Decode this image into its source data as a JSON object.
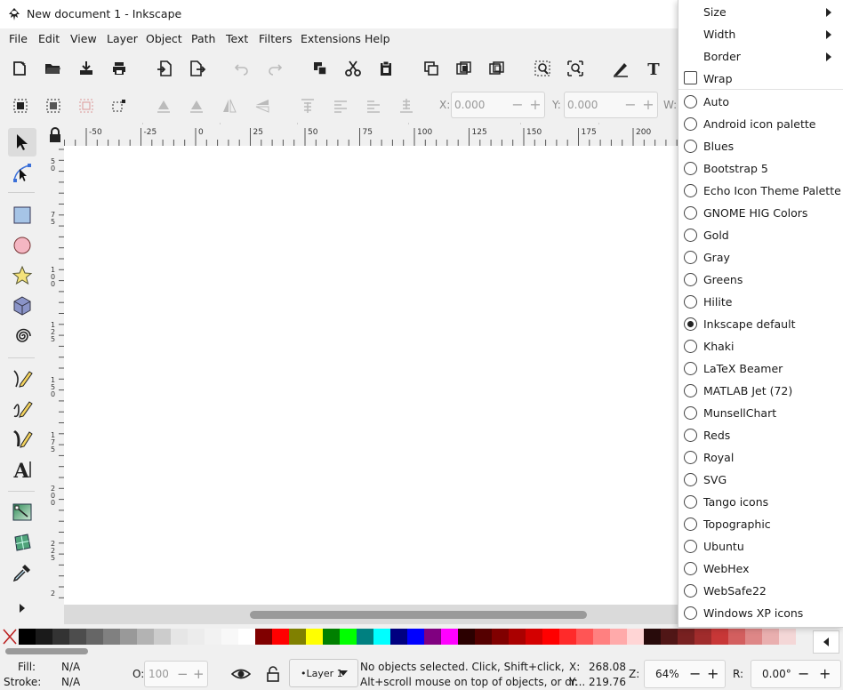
{
  "window": {
    "title": "New document 1 - Inkscape"
  },
  "menubar": [
    "File",
    "Edit",
    "View",
    "Layer",
    "Object",
    "Path",
    "Text",
    "Filters",
    "Extensions",
    "Help"
  ],
  "toolbar2": {
    "x_label": "X:",
    "x_value": "0.000",
    "y_label": "Y:",
    "y_value": "0.000",
    "w_label": "W:"
  },
  "ruler": {
    "h_ticks": [
      "-50",
      "-25",
      "0",
      "25",
      "50",
      "75",
      "100",
      "125",
      "150",
      "175",
      "200"
    ],
    "v_ticks": [
      "5\n0",
      "7\n5",
      "1\n0\n0",
      "1\n2\n5",
      "1\n5\n0",
      "1\n7\n5",
      "2\n0\n0",
      "2\n2\n5",
      "2"
    ]
  },
  "palette": {
    "colors": [
      "#000000",
      "#1a1a1a",
      "#333333",
      "#4d4d4d",
      "#666666",
      "#808080",
      "#999999",
      "#b3b3b3",
      "#cccccc",
      "#e6e6e6",
      "#ececec",
      "#f2f2f2",
      "#f8f8f8",
      "#ffffff",
      "#800000",
      "#ff0000",
      "#808000",
      "#ffff00",
      "#008000",
      "#00ff00",
      "#008080",
      "#00ffff",
      "#000080",
      "#0000ff",
      "#800080",
      "#ff00ff",
      "#2b0000",
      "#550000",
      "#800000",
      "#aa0000",
      "#d40000",
      "#ff0000",
      "#ff2a2a",
      "#ff5555",
      "#ff8080",
      "#ffaaaa",
      "#ffd5d5",
      "#280b0b",
      "#501616",
      "#782121",
      "#a02c2c",
      "#c83737",
      "#d35f5f",
      "#de8787",
      "#e9afaf",
      "#f4d7d7",
      "#241c1c"
    ]
  },
  "status": {
    "fill_label": "Fill:",
    "fill_value": "N/A",
    "stroke_label": "Stroke:",
    "stroke_value": "N/A",
    "opacity_label": "O:",
    "opacity_value": "100",
    "layer": "•Layer 1",
    "message_line1": "No objects selected. Click, Shift+click,",
    "message_line2": "Alt+scroll mouse on top of objects, or dr...",
    "x_label": "X:",
    "x_value": "268.08",
    "y_label": "Y:",
    "y_value": "219.76",
    "zoom_label": "Z:",
    "zoom_value": "64%",
    "rotate_label": "R:",
    "rotate_value": "0.00°"
  },
  "popup": {
    "submenus": [
      "Size",
      "Width",
      "Border"
    ],
    "wrap_label": "Wrap",
    "selected": "Inkscape default",
    "palettes": [
      "Auto",
      "Android icon palette",
      "Blues",
      "Bootstrap 5",
      "Echo Icon Theme Palette",
      "GNOME HIG Colors",
      "Gold",
      "Gray",
      "Greens",
      "Hilite",
      "Inkscape default",
      "Khaki",
      "LaTeX Beamer",
      "MATLAB Jet (72)",
      "MunsellChart",
      "Reds",
      "Royal",
      "SVG",
      "Tango icons",
      "Topographic",
      "Ubuntu",
      "WebHex",
      "WebSafe22",
      "Windows XP icons"
    ]
  }
}
